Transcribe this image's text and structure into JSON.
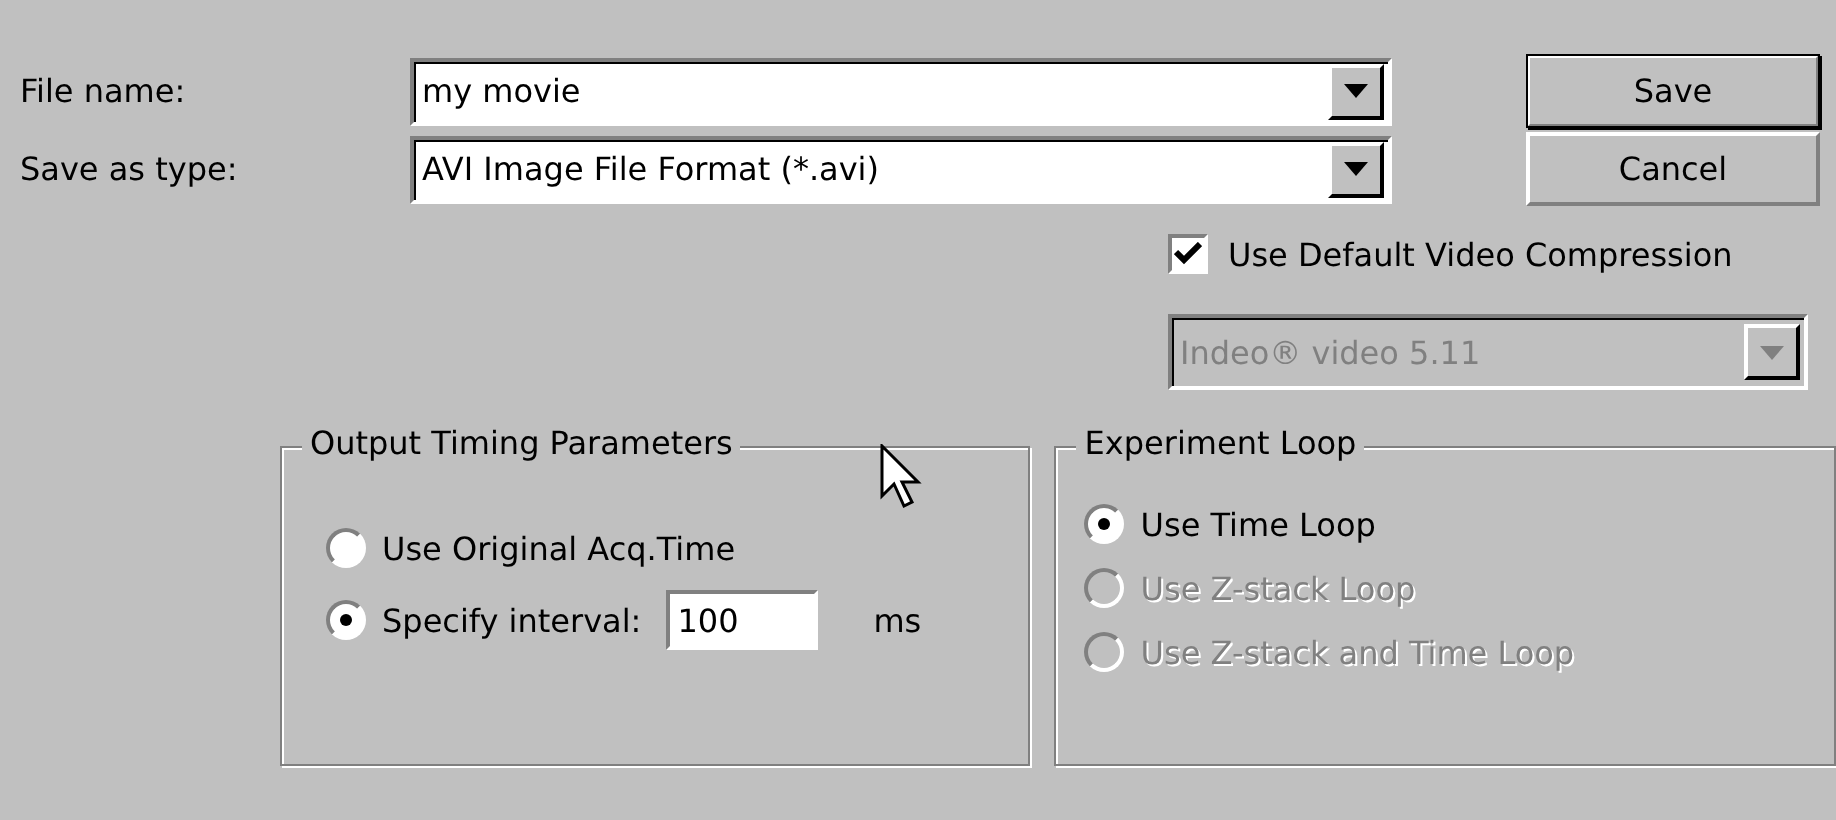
{
  "file_name": {
    "label": "File name:",
    "value": "my movie"
  },
  "save_as_type": {
    "label": "Save as type:",
    "value": "AVI Image File Format (*.avi)"
  },
  "buttons": [
    {
      "label": "Save",
      "default": true
    },
    {
      "label": "Cancel",
      "default": false
    }
  ],
  "compression": {
    "label": "Use Default Video Compression",
    "checked": true,
    "codec": {
      "value": "Indeo® video 5.11",
      "disabled": true
    }
  },
  "output_timing": {
    "title": "Output Timing Parameters",
    "options": [
      {
        "label": "Use Original Acq.Time",
        "selected": false,
        "kind": "plain"
      },
      {
        "label": "Specify interval:",
        "selected": true,
        "kind": "interval",
        "value": "100",
        "unit": "ms"
      }
    ]
  },
  "experiment_loop": {
    "title": "Experiment Loop",
    "options": [
      {
        "label": "Use Time Loop",
        "selected": true,
        "disabled": false
      },
      {
        "label": "Use Z-stack Loop",
        "selected": false,
        "disabled": true
      },
      {
        "label": "Use Z-stack and Time Loop",
        "selected": false,
        "disabled": true
      }
    ]
  }
}
